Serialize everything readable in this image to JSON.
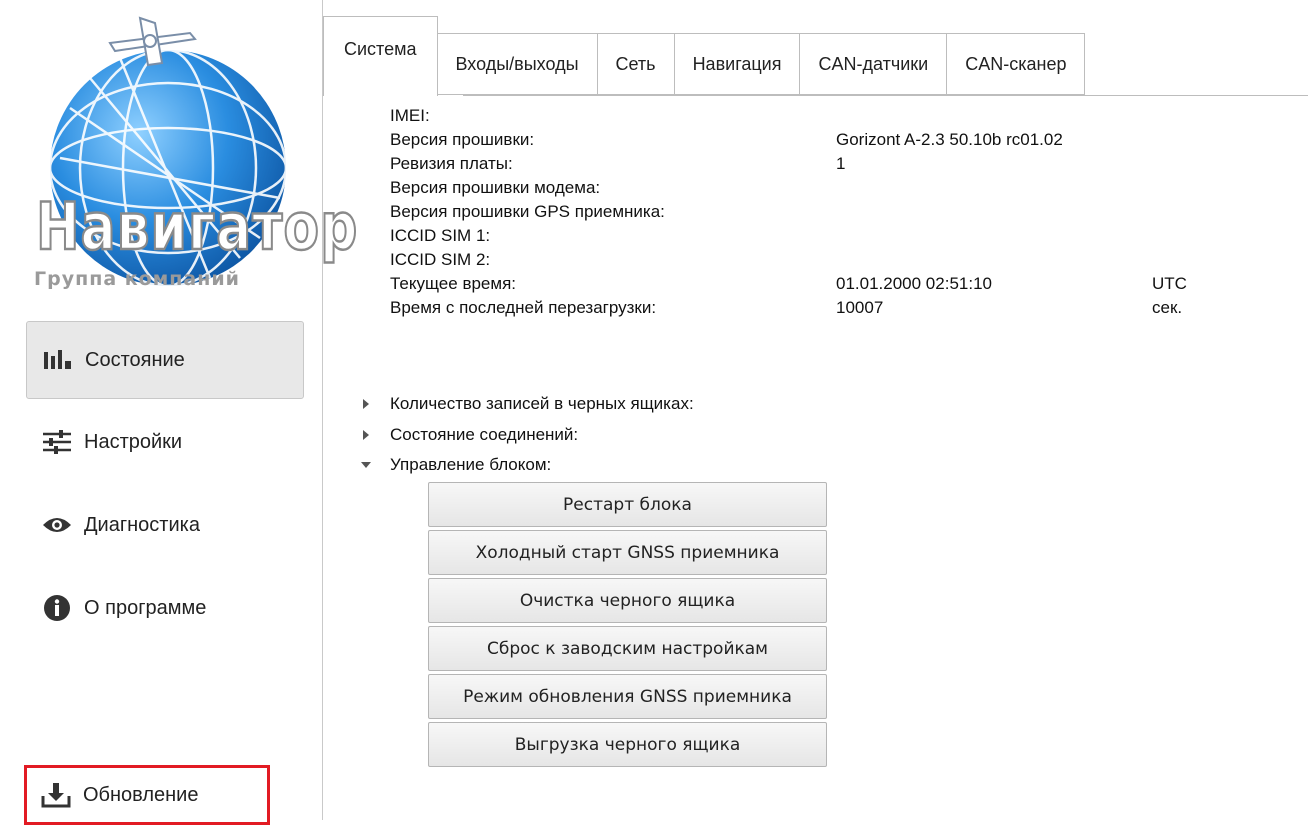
{
  "logo": {
    "title": "Навигатор",
    "subtitle": "Группа компаний"
  },
  "sidebar": {
    "items": [
      {
        "label": "Состояние",
        "icon": "bar-chart-icon"
      },
      {
        "label": "Настройки",
        "icon": "sliders-icon"
      },
      {
        "label": "Диагностика",
        "icon": "eye-icon"
      },
      {
        "label": "О программе",
        "icon": "info-icon"
      }
    ],
    "update": {
      "label": "Обновление",
      "icon": "download-icon"
    }
  },
  "tabs": [
    "Система",
    "Входы/выходы",
    "Сеть",
    "Навигация",
    "CAN-датчики",
    "CAN-сканер"
  ],
  "info": {
    "rows": [
      {
        "label": "IMEI:",
        "value": "",
        "unit": ""
      },
      {
        "label": "Версия прошивки:",
        "value": "Gorizont A-2.3 50.10b rc01.02",
        "unit": ""
      },
      {
        "label": "Ревизия платы:",
        "value": "1",
        "unit": ""
      },
      {
        "label": "Версия прошивки модема:",
        "value": "",
        "unit": ""
      },
      {
        "label": "Версия прошивки GPS приемника:",
        "value": "",
        "unit": ""
      },
      {
        "label": "ICCID SIM 1:",
        "value": "",
        "unit": ""
      },
      {
        "label": "ICCID SIM 2:",
        "value": "",
        "unit": ""
      },
      {
        "label": "Текущее время:",
        "value": "01.01.2000 02:51:10",
        "unit": "UTC"
      },
      {
        "label": "Время с последней перезагрузки:",
        "value": "10007",
        "unit": "сек."
      }
    ],
    "tree": [
      {
        "label": "Количество записей в черных ящиках:",
        "expanded": false
      },
      {
        "label": "Состояние соединений:",
        "expanded": false
      },
      {
        "label": "Управление блоком:",
        "expanded": true
      }
    ]
  },
  "buttons": [
    "Рестарт блока",
    "Холодный старт GNSS приемника",
    "Очистка черного ящика",
    "Сброс к заводским настройкам",
    "Режим обновления GNSS приемника",
    "Выгрузка черного ящика"
  ],
  "colors": {
    "accent": "#e21b23",
    "globe": "#1d7ccf"
  }
}
